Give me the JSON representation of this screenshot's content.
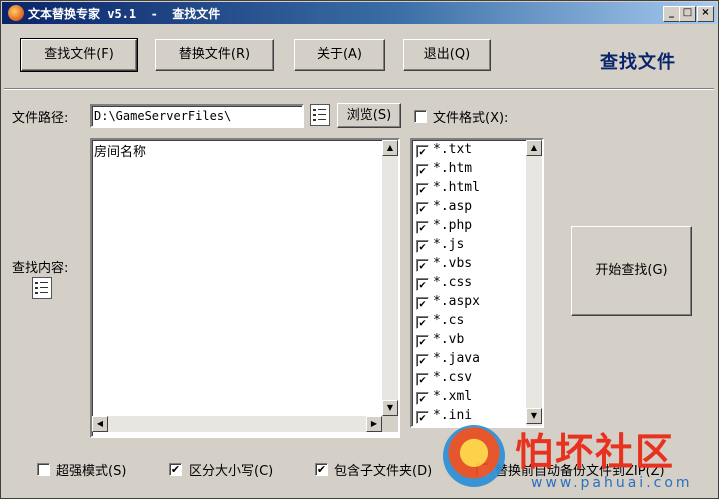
{
  "window": {
    "title": "文本替换专家 v5.1  -  查找文件"
  },
  "toolbar": {
    "find_label": "查找文件(F)",
    "replace_label": "替换文件(R)",
    "about_label": "关于(A)",
    "exit_label": "退出(Q)",
    "mode_title": "查找文件"
  },
  "path": {
    "label": "文件路径:",
    "value": "D:\\GameServerFiles\\",
    "browse_label": "浏览(S)"
  },
  "file_format": {
    "label": "文件格式(X):",
    "checked": false,
    "items": [
      {
        "label": "*.txt",
        "checked": true
      },
      {
        "label": "*.htm",
        "checked": true
      },
      {
        "label": "*.html",
        "checked": true
      },
      {
        "label": "*.asp",
        "checked": true
      },
      {
        "label": "*.php",
        "checked": true
      },
      {
        "label": "*.js",
        "checked": true
      },
      {
        "label": "*.vbs",
        "checked": true
      },
      {
        "label": "*.css",
        "checked": true
      },
      {
        "label": "*.aspx",
        "checked": true
      },
      {
        "label": "*.cs",
        "checked": true
      },
      {
        "label": "*.vb",
        "checked": true
      },
      {
        "label": "*.java",
        "checked": true
      },
      {
        "label": "*.csv",
        "checked": true
      },
      {
        "label": "*.xml",
        "checked": true
      },
      {
        "label": "*.ini",
        "checked": true
      }
    ]
  },
  "search": {
    "label": "查找内容:",
    "content": "房间名称"
  },
  "start_button": {
    "label": "开始查找(G)"
  },
  "options": {
    "super_mode": {
      "label": "超强模式(S)",
      "checked": false
    },
    "case_sensitive": {
      "label": "区分大小写(C)",
      "checked": true
    },
    "include_subfolders": {
      "label": "包含子文件夹(D)",
      "checked": true
    },
    "auto_backup": {
      "label": "替换前自动备份文件到ZIP(Z)",
      "checked": false
    }
  },
  "watermark": {
    "name": "怕坏社区",
    "url": "www.pahuai.com"
  }
}
